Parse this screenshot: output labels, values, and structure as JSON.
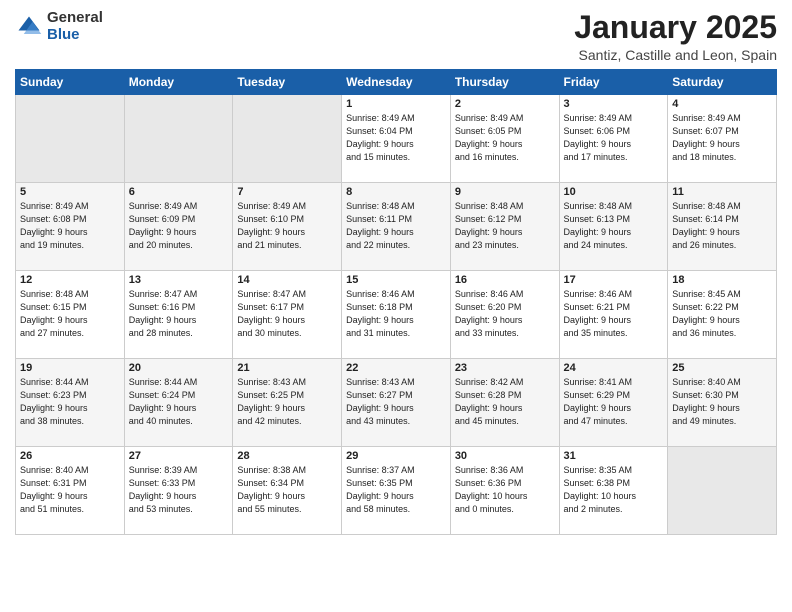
{
  "header": {
    "logo_general": "General",
    "logo_blue": "Blue",
    "title": "January 2025",
    "location": "Santiz, Castille and Leon, Spain"
  },
  "weekdays": [
    "Sunday",
    "Monday",
    "Tuesday",
    "Wednesday",
    "Thursday",
    "Friday",
    "Saturday"
  ],
  "weeks": [
    [
      {
        "day": "",
        "info": ""
      },
      {
        "day": "",
        "info": ""
      },
      {
        "day": "",
        "info": ""
      },
      {
        "day": "1",
        "info": "Sunrise: 8:49 AM\nSunset: 6:04 PM\nDaylight: 9 hours\nand 15 minutes."
      },
      {
        "day": "2",
        "info": "Sunrise: 8:49 AM\nSunset: 6:05 PM\nDaylight: 9 hours\nand 16 minutes."
      },
      {
        "day": "3",
        "info": "Sunrise: 8:49 AM\nSunset: 6:06 PM\nDaylight: 9 hours\nand 17 minutes."
      },
      {
        "day": "4",
        "info": "Sunrise: 8:49 AM\nSunset: 6:07 PM\nDaylight: 9 hours\nand 18 minutes."
      }
    ],
    [
      {
        "day": "5",
        "info": "Sunrise: 8:49 AM\nSunset: 6:08 PM\nDaylight: 9 hours\nand 19 minutes."
      },
      {
        "day": "6",
        "info": "Sunrise: 8:49 AM\nSunset: 6:09 PM\nDaylight: 9 hours\nand 20 minutes."
      },
      {
        "day": "7",
        "info": "Sunrise: 8:49 AM\nSunset: 6:10 PM\nDaylight: 9 hours\nand 21 minutes."
      },
      {
        "day": "8",
        "info": "Sunrise: 8:48 AM\nSunset: 6:11 PM\nDaylight: 9 hours\nand 22 minutes."
      },
      {
        "day": "9",
        "info": "Sunrise: 8:48 AM\nSunset: 6:12 PM\nDaylight: 9 hours\nand 23 minutes."
      },
      {
        "day": "10",
        "info": "Sunrise: 8:48 AM\nSunset: 6:13 PM\nDaylight: 9 hours\nand 24 minutes."
      },
      {
        "day": "11",
        "info": "Sunrise: 8:48 AM\nSunset: 6:14 PM\nDaylight: 9 hours\nand 26 minutes."
      }
    ],
    [
      {
        "day": "12",
        "info": "Sunrise: 8:48 AM\nSunset: 6:15 PM\nDaylight: 9 hours\nand 27 minutes."
      },
      {
        "day": "13",
        "info": "Sunrise: 8:47 AM\nSunset: 6:16 PM\nDaylight: 9 hours\nand 28 minutes."
      },
      {
        "day": "14",
        "info": "Sunrise: 8:47 AM\nSunset: 6:17 PM\nDaylight: 9 hours\nand 30 minutes."
      },
      {
        "day": "15",
        "info": "Sunrise: 8:46 AM\nSunset: 6:18 PM\nDaylight: 9 hours\nand 31 minutes."
      },
      {
        "day": "16",
        "info": "Sunrise: 8:46 AM\nSunset: 6:20 PM\nDaylight: 9 hours\nand 33 minutes."
      },
      {
        "day": "17",
        "info": "Sunrise: 8:46 AM\nSunset: 6:21 PM\nDaylight: 9 hours\nand 35 minutes."
      },
      {
        "day": "18",
        "info": "Sunrise: 8:45 AM\nSunset: 6:22 PM\nDaylight: 9 hours\nand 36 minutes."
      }
    ],
    [
      {
        "day": "19",
        "info": "Sunrise: 8:44 AM\nSunset: 6:23 PM\nDaylight: 9 hours\nand 38 minutes."
      },
      {
        "day": "20",
        "info": "Sunrise: 8:44 AM\nSunset: 6:24 PM\nDaylight: 9 hours\nand 40 minutes."
      },
      {
        "day": "21",
        "info": "Sunrise: 8:43 AM\nSunset: 6:25 PM\nDaylight: 9 hours\nand 42 minutes."
      },
      {
        "day": "22",
        "info": "Sunrise: 8:43 AM\nSunset: 6:27 PM\nDaylight: 9 hours\nand 43 minutes."
      },
      {
        "day": "23",
        "info": "Sunrise: 8:42 AM\nSunset: 6:28 PM\nDaylight: 9 hours\nand 45 minutes."
      },
      {
        "day": "24",
        "info": "Sunrise: 8:41 AM\nSunset: 6:29 PM\nDaylight: 9 hours\nand 47 minutes."
      },
      {
        "day": "25",
        "info": "Sunrise: 8:40 AM\nSunset: 6:30 PM\nDaylight: 9 hours\nand 49 minutes."
      }
    ],
    [
      {
        "day": "26",
        "info": "Sunrise: 8:40 AM\nSunset: 6:31 PM\nDaylight: 9 hours\nand 51 minutes."
      },
      {
        "day": "27",
        "info": "Sunrise: 8:39 AM\nSunset: 6:33 PM\nDaylight: 9 hours\nand 53 minutes."
      },
      {
        "day": "28",
        "info": "Sunrise: 8:38 AM\nSunset: 6:34 PM\nDaylight: 9 hours\nand 55 minutes."
      },
      {
        "day": "29",
        "info": "Sunrise: 8:37 AM\nSunset: 6:35 PM\nDaylight: 9 hours\nand 58 minutes."
      },
      {
        "day": "30",
        "info": "Sunrise: 8:36 AM\nSunset: 6:36 PM\nDaylight: 10 hours\nand 0 minutes."
      },
      {
        "day": "31",
        "info": "Sunrise: 8:35 AM\nSunset: 6:38 PM\nDaylight: 10 hours\nand 2 minutes."
      },
      {
        "day": "",
        "info": ""
      }
    ]
  ]
}
